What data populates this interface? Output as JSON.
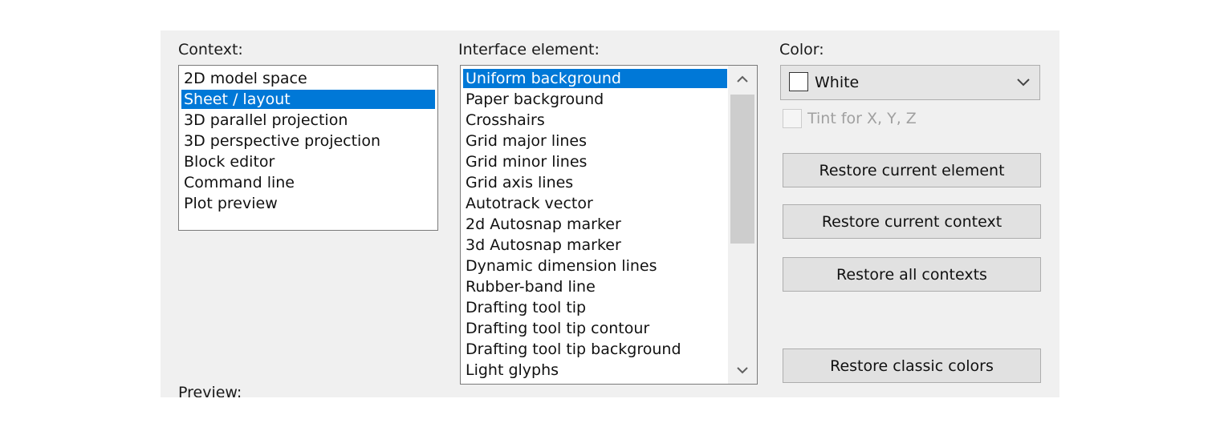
{
  "context": {
    "label": "Context:",
    "items": [
      "2D model space",
      "Sheet / layout",
      "3D parallel projection",
      "3D perspective projection",
      "Block editor",
      "Command line",
      "Plot preview"
    ],
    "selected": "Sheet / layout"
  },
  "interface_element": {
    "label": "Interface element:",
    "items": [
      "Uniform background",
      "Paper background",
      "Crosshairs",
      "Grid major lines",
      "Grid minor lines",
      "Grid axis lines",
      "Autotrack vector",
      "2d Autosnap marker",
      "3d Autosnap marker",
      "Dynamic dimension lines",
      "Rubber-band line",
      "Drafting tool tip",
      "Drafting tool tip contour",
      "Drafting tool tip background",
      "Light glyphs"
    ],
    "selected": "Uniform background",
    "scroll_up_icon": "chevron-up-icon",
    "scroll_down_icon": "chevron-down-icon"
  },
  "color": {
    "label": "Color:",
    "value": "White",
    "swatch_color": "#ffffff",
    "dropdown_icon": "chevron-down-icon"
  },
  "tint": {
    "label": "Tint for X, Y, Z",
    "checked": false,
    "enabled": false
  },
  "buttons": {
    "restore_element": "Restore current element",
    "restore_context": "Restore current context",
    "restore_all": "Restore all contexts",
    "restore_classic": "Restore classic colors"
  },
  "preview": {
    "label": "Preview:"
  },
  "colors": {
    "selection": "#0078d7",
    "dialog_background": "#f0f0f0"
  }
}
